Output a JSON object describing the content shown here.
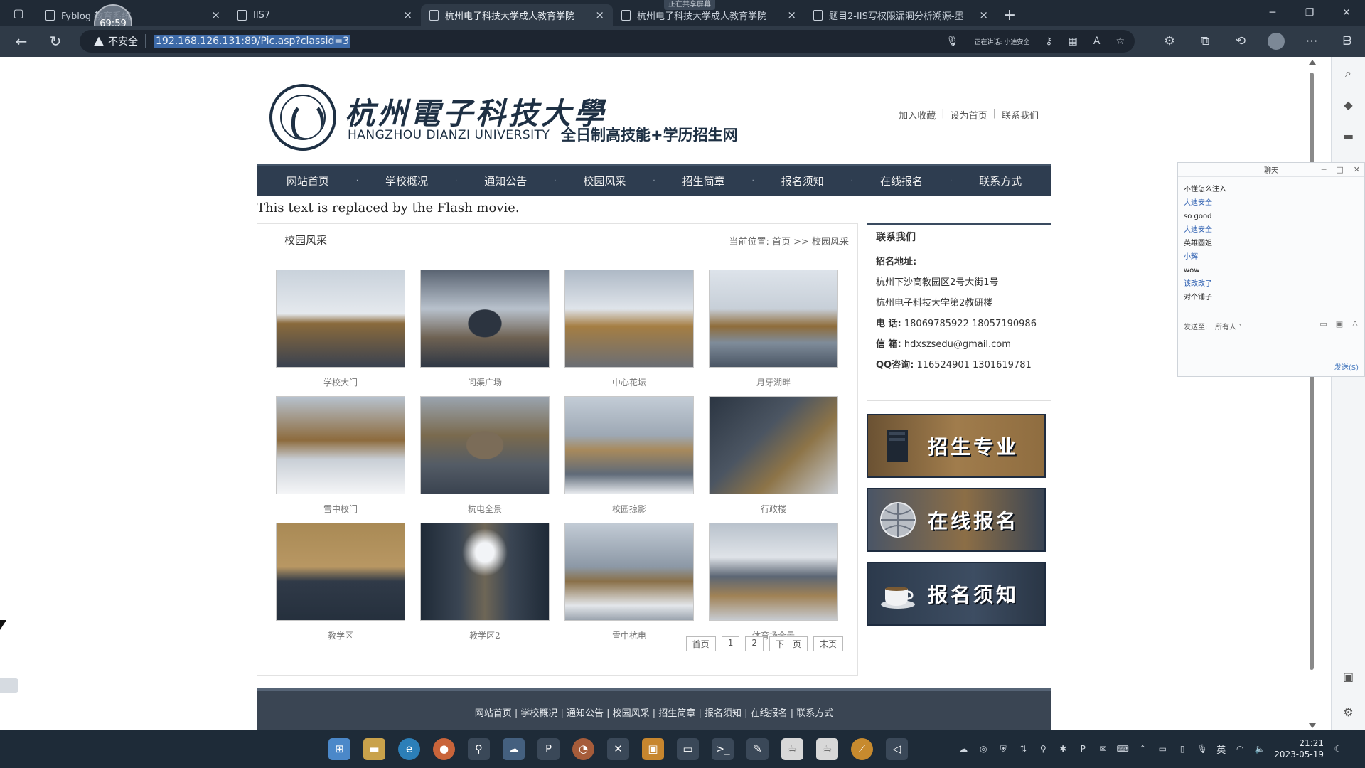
{
  "browser": {
    "timer": "69:59",
    "share_banner": "正在共享屏幕",
    "tabs": [
      {
        "label": "Fyblog 教育系统",
        "active": false
      },
      {
        "label": "IIS7",
        "active": false
      },
      {
        "label": "杭州电子科技大学成人教育学院",
        "active": true
      },
      {
        "label": "杭州电子科技大学成人教育学院",
        "active": false
      },
      {
        "label": "题目2-IIS写权限漏洞分析溯源-墨",
        "active": false
      }
    ],
    "new_tab": "+",
    "insecure_label": "不安全",
    "url": "192.168.126.131:89/Pic.asp?classid=3",
    "speaking_label": "正在讲话: 小迪安全"
  },
  "site": {
    "logo_cn": "杭州電子科技大學",
    "logo_en": "HANGZHOU DIANZI UNIVERSITY",
    "subtitle": "全日制高技能+学历招生网",
    "toplinks": [
      "加入收藏",
      "设为首页",
      "联系我们"
    ],
    "nav": [
      "网站首页",
      "学校概况",
      "通知公告",
      "校园风采",
      "招生简章",
      "报名须知",
      "在线报名",
      "联系方式"
    ],
    "flash_text": "This text is replaced by the Flash movie.",
    "section_title": "校园风采",
    "breadcrumb": "当前位置: 首页 >> 校园风采",
    "gallery": [
      {
        "caption": "学校大门"
      },
      {
        "caption": "问渠广场"
      },
      {
        "caption": "中心花坛"
      },
      {
        "caption": "月牙湖畔"
      },
      {
        "caption": "雪中校门"
      },
      {
        "caption": "杭电全景"
      },
      {
        "caption": "校园掠影"
      },
      {
        "caption": "行政楼"
      },
      {
        "caption": "教学区"
      },
      {
        "caption": "教学区2"
      },
      {
        "caption": "雪中杭电"
      },
      {
        "caption": "体育场全景"
      }
    ],
    "pager": [
      "首页",
      "1",
      "2",
      "下一页",
      "末页"
    ],
    "contact": {
      "title": "联系我们",
      "address_label": "招名地址:",
      "address1": "杭州下沙高教园区2号大街1号",
      "address2": "杭州电子科技大学第2教研楼",
      "phone_label": "电 话:",
      "phone": "18069785922 18057190986",
      "email_label": "信 箱:",
      "email": "hdxszsedu@gmail.com",
      "qq_label": "QQ咨询:",
      "qq": "116524901 1301619781"
    },
    "promos": [
      "招生专业",
      "在线报名",
      "报名须知"
    ],
    "footer_links": "网站首页 | 学校概况 | 通知公告 | 校园风采 | 招生简章 | 报名须知 | 在线报名 | 联系方式"
  },
  "chat": {
    "title": "聊天",
    "messages": [
      {
        "text": "不懂怎么注入",
        "type": "msg"
      },
      {
        "text": "大迪安全",
        "type": "name"
      },
      {
        "text": "so good",
        "type": "msg"
      },
      {
        "text": "大迪安全",
        "type": "name"
      },
      {
        "text": "英雄圆姐",
        "type": "msg"
      },
      {
        "text": "小辉",
        "type": "name"
      },
      {
        "text": "wow",
        "type": "msg"
      },
      {
        "text": "该改改了",
        "type": "name"
      },
      {
        "text": "对个锤子",
        "type": "msg"
      }
    ],
    "send_to_label": "发送至:",
    "send_to_value": "所有人 ˅",
    "send_button": "发送(S)"
  },
  "taskbar": {
    "ime": "英",
    "time": "21:21",
    "date": "2023-05-19"
  }
}
